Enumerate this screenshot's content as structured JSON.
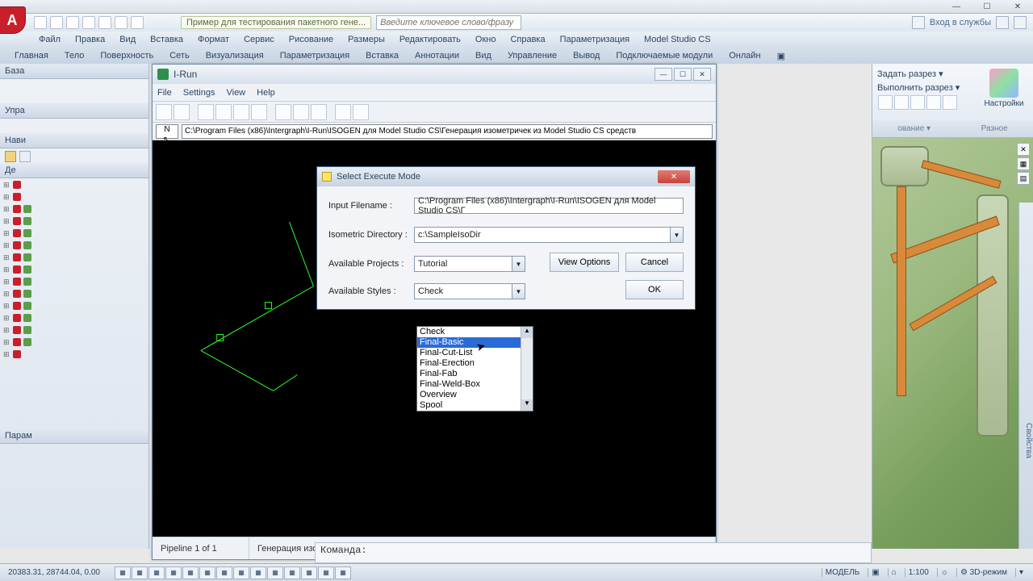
{
  "os": {
    "min": "—",
    "max": "☐",
    "close": "✕"
  },
  "qat": {
    "icons": [
      "▢",
      "▢",
      "▢",
      "▢",
      "▢",
      "▢",
      "▢"
    ]
  },
  "doc_title": "Пример для тестирования пакетного гене...",
  "search_placeholder": "Введите ключевое слово/фразу",
  "right_tools": {
    "login": "Вход в службы",
    "help": "?"
  },
  "menubar1": [
    "Файл",
    "Правка",
    "Вид",
    "Вставка",
    "Формат",
    "Сервис",
    "Рисование",
    "Размеры",
    "Редактировать",
    "Окно",
    "Справка",
    "Параметризация",
    "Model Studio CS"
  ],
  "menubar2": [
    "Главная",
    "Тело",
    "Поверхность",
    "Сеть",
    "Визуализация",
    "Параметризация",
    "Вставка",
    "Аннотации",
    "Вид",
    "Управление",
    "Вывод",
    "Подключаемые модули",
    "Онлайн",
    "▣"
  ],
  "left": {
    "h1": "База",
    "h2": "Упра",
    "h3": "Нави",
    "h4": "Де",
    "h5": "Парам",
    "tree_nodes": [
      "",
      "",
      "",
      "",
      "",
      "",
      "",
      "",
      "",
      "",
      "",
      "",
      "",
      "",
      "",
      ""
    ]
  },
  "ribbon_right": {
    "r1": "Задать разрез ▾",
    "r2": "Выполнить разрез ▾",
    "r3": "ование ▾",
    "big_lbl": "Настройки",
    "cap2": "Разное"
  },
  "irun": {
    "title": "I-Run",
    "menu": [
      "File",
      "Settings",
      "View",
      "Help"
    ],
    "n": "N",
    "path": "C:\\Program Files (x86)\\Intergraph\\I-Run\\ISOGEN для Model Studio CS\\Генерация изометричек из Model Studio CS средств",
    "status_left": "Pipeline  1 of  1",
    "status_right": "Генерация изометричек из Model Studio CS средствами ISOGEN (I-Run).pcf"
  },
  "dlg": {
    "title": "Select Execute Mode",
    "lbl_input": "Input Filename :",
    "val_input": "C:\\Program Files (x86)\\Intergraph\\I-Run\\ISOGEN для Model Studio CS\\Г",
    "lbl_iso": "Isometric Directory :",
    "val_iso": "c:\\SampleIsoDir",
    "lbl_proj": "Available Projects :",
    "val_proj": "Tutorial",
    "lbl_style": "Available Styles :",
    "val_style": "Check",
    "btn_view": "View Options",
    "btn_cancel": "Cancel",
    "btn_ok": "OK",
    "close": "✕"
  },
  "dropdown": {
    "options": [
      "Check",
      "Final-Basic",
      "Final-Cut-List",
      "Final-Erection",
      "Final-Fab",
      "Final-Weld-Box",
      "Overview",
      "Spool"
    ],
    "selected_index": 1
  },
  "cmd": {
    "prompt": "Команда:"
  },
  "status": {
    "coord": "20383.31, 28744.04, 0.00",
    "right": [
      "МОДЕЛЬ",
      "▣",
      "⌂",
      "1:100",
      "☼",
      "⚙ 3D-режим",
      "▾"
    ]
  },
  "vp_side": "Свойства"
}
